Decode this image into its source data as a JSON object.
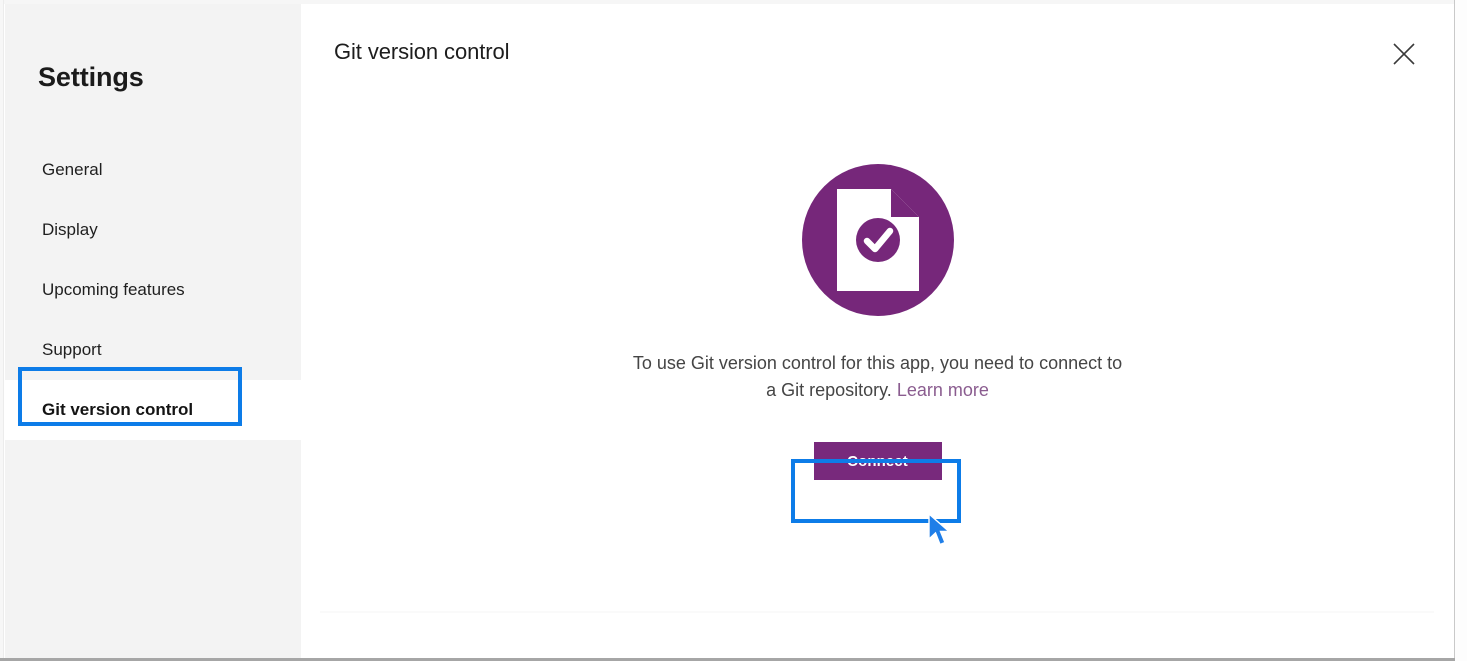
{
  "theme": {
    "accent_purple": "#76277a",
    "button_purple": "#78297c",
    "link_purple": "#8a5c8f",
    "annotation_blue": "#0d7ce8",
    "sidebar_bg": "#f3f3f3",
    "content_bg": "#ffffff"
  },
  "sidebar": {
    "title": "Settings",
    "items": [
      {
        "label": "General",
        "selected": false
      },
      {
        "label": "Display",
        "selected": false
      },
      {
        "label": "Upcoming features",
        "selected": false
      },
      {
        "label": "Support",
        "selected": false
      },
      {
        "label": "Git version control",
        "selected": true
      }
    ]
  },
  "panel": {
    "title": "Git version control",
    "close_icon": "close-x-icon"
  },
  "empty_state": {
    "icon_name": "document-check-circle-icon",
    "message_line_1": "To use Git version control for this app, you need to",
    "message_line_2": "connect to a Git repository.",
    "link_label": "Learn more",
    "primary_button_label": "Connect"
  },
  "annotations": {
    "sidebar_highlight_target": "Git version control",
    "button_highlight_target": "Connect",
    "cursor_icon": "mouse-pointer-icon"
  }
}
